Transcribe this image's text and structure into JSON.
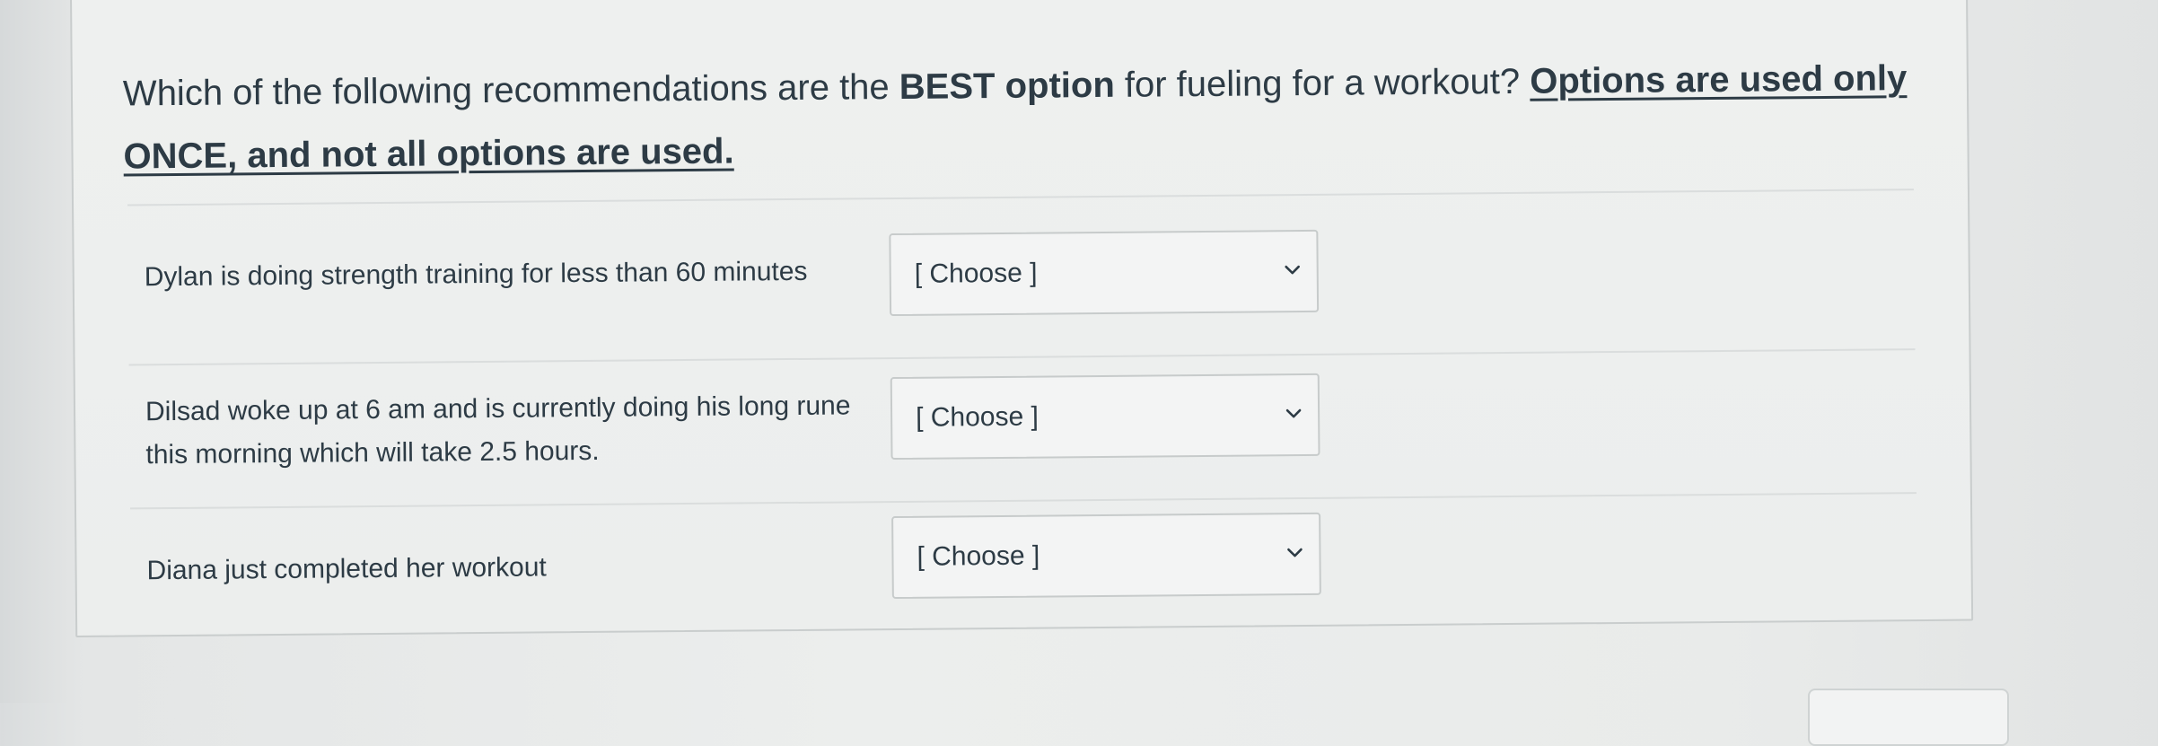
{
  "question": {
    "text_start": "Which of the following recommendations are the ",
    "text_bold": "BEST option",
    "text_middle": " for fueling for a workout? ",
    "text_emphasis": "Options are used only ONCE, and not all options are used."
  },
  "rows": [
    {
      "label": "Dylan is doing strength training for less than 60 minutes",
      "select_value": "[ Choose ]"
    },
    {
      "label": "Dilsad woke up at 6 am and is currently doing his long rune this morning which will take 2.5 hours.",
      "select_value": "[ Choose ]"
    },
    {
      "label": "Diana just completed her workout",
      "select_value": "[ Choose ]"
    }
  ],
  "icons": {
    "dropdown": "chevron-down-icon"
  },
  "colors": {
    "text": "#2d3b45",
    "border": "#c7cbcb",
    "background": "#eceeed"
  }
}
